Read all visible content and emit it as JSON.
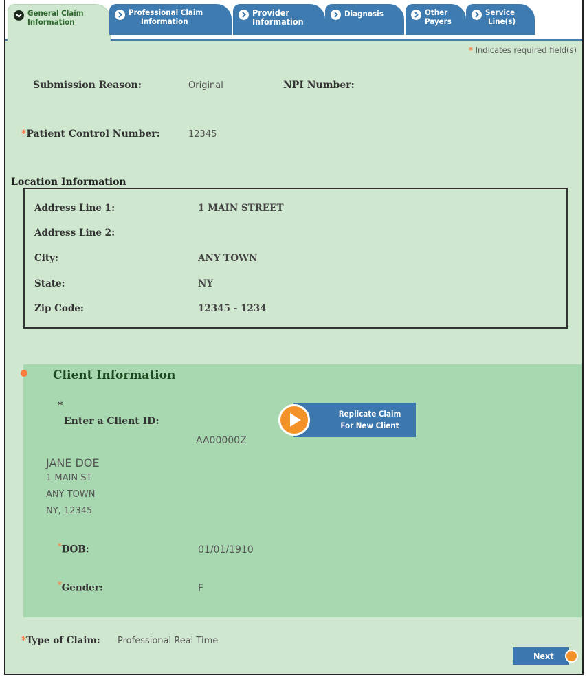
{
  "tabs": [
    {
      "line1": "General Claim",
      "line2": "Information"
    },
    {
      "line1": "Professional Claim",
      "line2": "Information"
    },
    {
      "line1": "Provider",
      "line2": "Information"
    },
    {
      "line1": "Diagnosis",
      "line2": ""
    },
    {
      "line1": "Other",
      "line2": "Payers"
    },
    {
      "line1": "Service",
      "line2": "Line(s)"
    }
  ],
  "required_note": "Indicates required field(s)",
  "required_marker": "*",
  "general": {
    "submission_reason_label": "Submission Reason:",
    "submission_reason_value": "Original",
    "npi_label": "NPI Number:",
    "patient_control_label": "Patient Control Number:",
    "patient_control_value": "12345"
  },
  "location": {
    "title": "Location Information",
    "rows": [
      {
        "label": "Address Line 1:",
        "value": "1 MAIN STREET"
      },
      {
        "label": "Address Line 2:",
        "value": ""
      },
      {
        "label": "City:",
        "value": "ANY TOWN"
      },
      {
        "label": "State:",
        "value": "NY"
      },
      {
        "label": "Zip Code:",
        "value": "12345 - 1234"
      }
    ]
  },
  "client": {
    "title": "Client Information",
    "client_id_label": "Enter a Client ID:",
    "client_id_value": "AA00000Z",
    "replicate_line1": "Replicate Claim",
    "replicate_line2": "For New Client",
    "name": "JANE DOE",
    "addr1": "1 MAIN ST",
    "addr2": "ANY TOWN",
    "addr3": "NY, 12345",
    "dob_label": "DOB:",
    "dob_value": "01/01/1910",
    "gender_label": "Gender:",
    "gender_value": "F"
  },
  "claim_type_label": "Type of Claim:",
  "claim_type_value": "Professional Real Time",
  "next_label": "Next",
  "colors": {
    "accent_blue": "#3c77ad",
    "required_orange": "#ff7a3c",
    "panel_green": "#cfe6cf",
    "client_green": "#a8d8b0"
  }
}
